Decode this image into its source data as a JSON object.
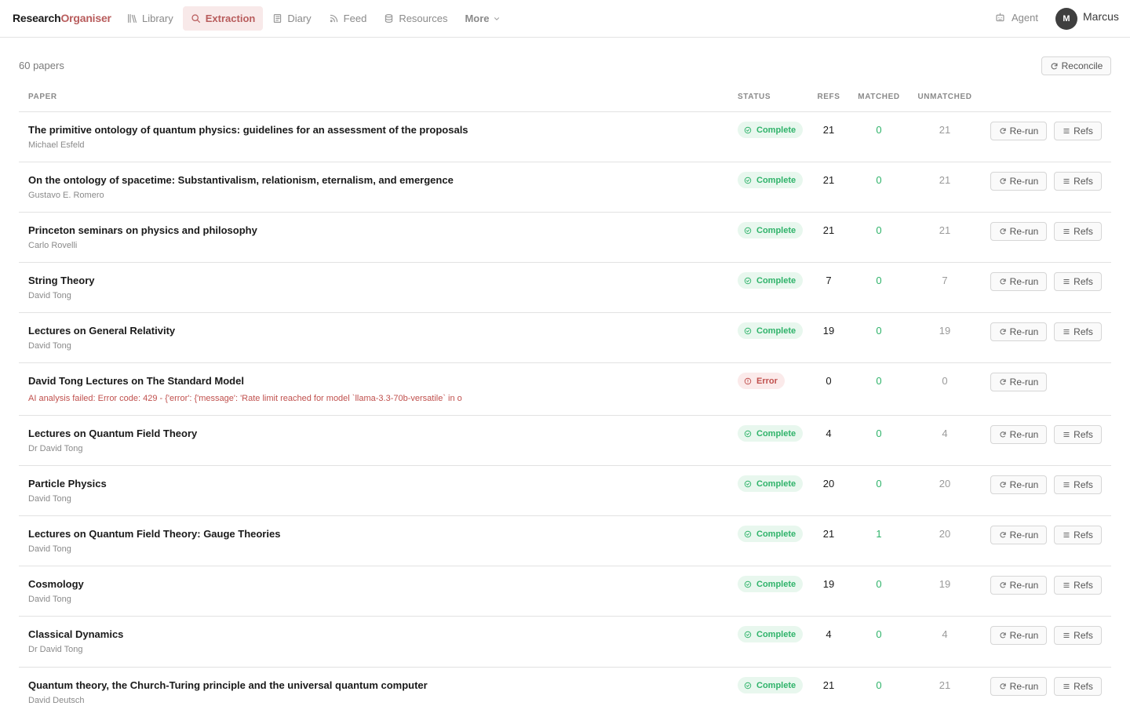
{
  "brand": {
    "part1": "Research",
    "part2": "Organiser"
  },
  "nav": {
    "library": "Library",
    "extraction": "Extraction",
    "diary": "Diary",
    "feed": "Feed",
    "resources": "Resources",
    "more": "More"
  },
  "agent_label": "Agent",
  "user": {
    "initial": "M",
    "name": "Marcus"
  },
  "paper_count": "60 papers",
  "reconcile_label": "Reconcile",
  "columns": {
    "paper": "PAPER",
    "status": "STATUS",
    "refs": "REFS",
    "matched": "MATCHED",
    "unmatched": "UNMATCHED"
  },
  "rerun_label": "Re-run",
  "refs_label": "Refs",
  "colors": {
    "accent": "#b85c5c",
    "success": "#2fb36a",
    "error": "#c0504d"
  },
  "papers": [
    {
      "title": "The primitive ontology of quantum physics: guidelines for an assessment of the proposals",
      "author": "Michael Esfeld",
      "status": "Complete",
      "refs": "21",
      "matched": "0",
      "unmatched": "21",
      "has_refs": true
    },
    {
      "title": "On the ontology of spacetime: Substantivalism, relationism, eternalism, and emergence",
      "author": "Gustavo E. Romero",
      "status": "Complete",
      "refs": "21",
      "matched": "0",
      "unmatched": "21",
      "has_refs": true
    },
    {
      "title": "Princeton seminars on physics and philosophy",
      "author": "Carlo Rovelli",
      "status": "Complete",
      "refs": "21",
      "matched": "0",
      "unmatched": "21",
      "has_refs": true
    },
    {
      "title": "String Theory",
      "author": "David Tong",
      "status": "Complete",
      "refs": "7",
      "matched": "0",
      "unmatched": "7",
      "has_refs": true
    },
    {
      "title": "Lectures on General Relativity",
      "author": "David Tong",
      "status": "Complete",
      "refs": "19",
      "matched": "0",
      "unmatched": "19",
      "has_refs": true
    },
    {
      "title": "David Tong Lectures on The Standard Model",
      "error": "AI analysis failed: Error code: 429 - {'error': {'message': 'Rate limit reached for model `llama-3.3-70b-versatile` in o",
      "status": "Error",
      "refs": "0",
      "matched": "0",
      "unmatched": "0",
      "has_refs": false
    },
    {
      "title": "Lectures on Quantum Field Theory",
      "author": "Dr David Tong",
      "status": "Complete",
      "refs": "4",
      "matched": "0",
      "unmatched": "4",
      "has_refs": true
    },
    {
      "title": "Particle Physics",
      "author": "David Tong",
      "status": "Complete",
      "refs": "20",
      "matched": "0",
      "unmatched": "20",
      "has_refs": true
    },
    {
      "title": "Lectures on Quantum Field Theory: Gauge Theories",
      "author": "David Tong",
      "status": "Complete",
      "refs": "21",
      "matched": "1",
      "unmatched": "20",
      "has_refs": true
    },
    {
      "title": "Cosmology",
      "author": "David Tong",
      "status": "Complete",
      "refs": "19",
      "matched": "0",
      "unmatched": "19",
      "has_refs": true
    },
    {
      "title": "Classical Dynamics",
      "author": "Dr David Tong",
      "status": "Complete",
      "refs": "4",
      "matched": "0",
      "unmatched": "4",
      "has_refs": true
    },
    {
      "title": "Quantum theory, the Church-Turing principle and the universal quantum computer",
      "author": "David Deutsch",
      "status": "Complete",
      "refs": "21",
      "matched": "0",
      "unmatched": "21",
      "has_refs": true
    }
  ]
}
